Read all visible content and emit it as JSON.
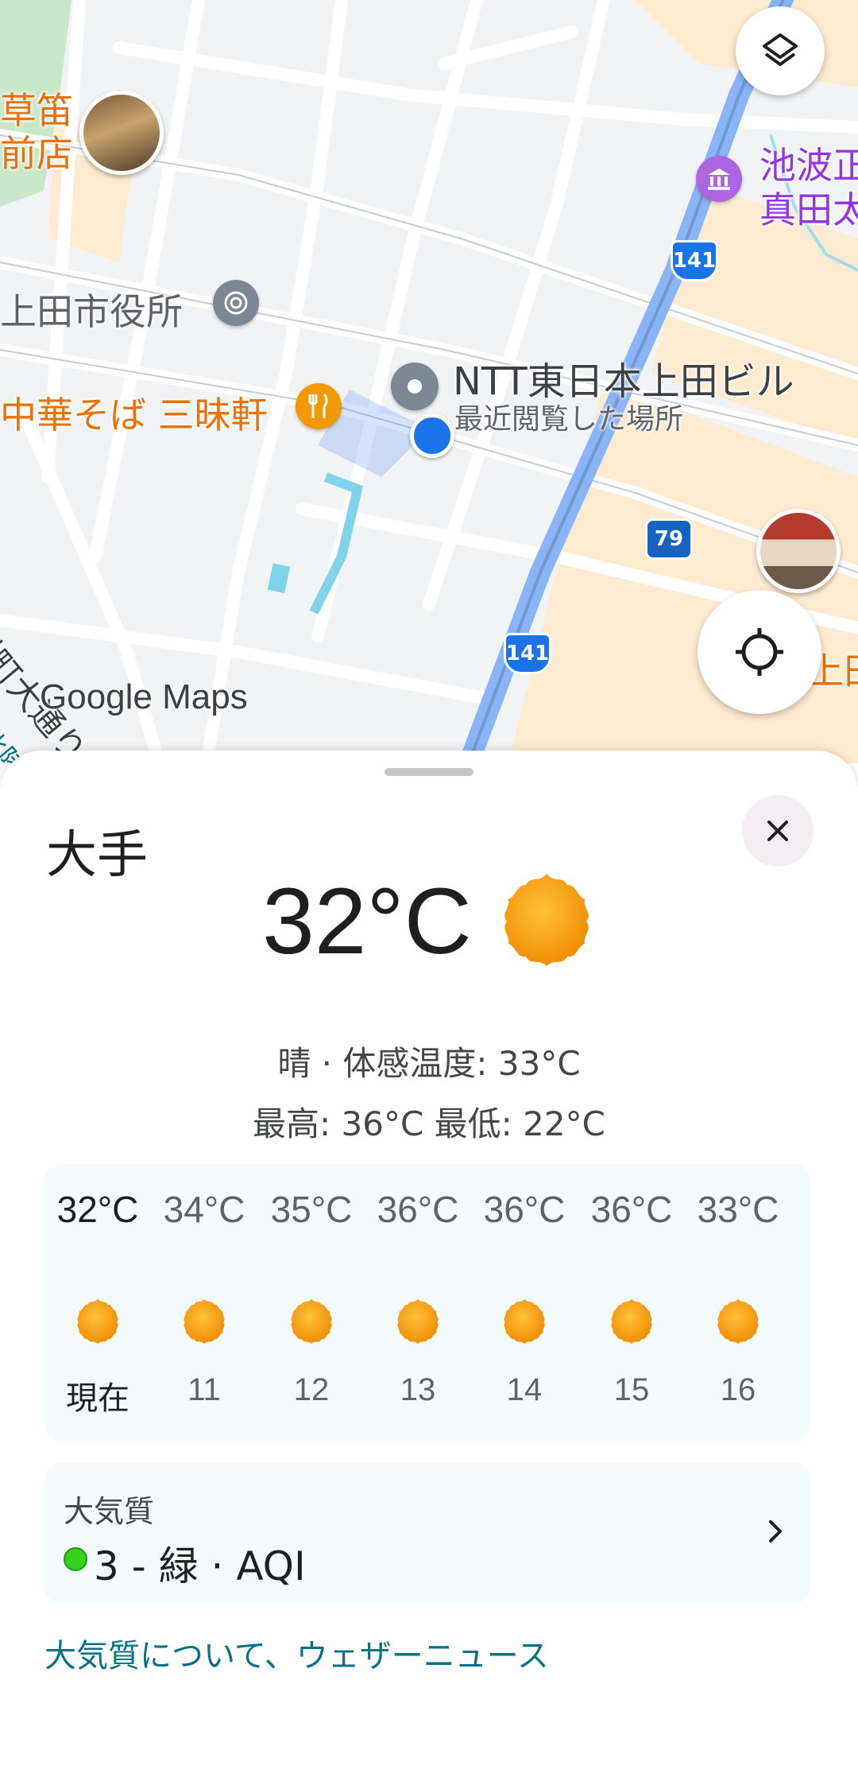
{
  "map": {
    "logo_text": "Google Maps",
    "labels": {
      "restaurant_top_left_line1": "草笛",
      "restaurant_top_left_line2": "前店",
      "city_hall": "上田市役所",
      "ramen": "中華そば 三昧軒",
      "ntt_title": "NTT東日本上田ビル",
      "ntt_subtitle": "最近閲覧した場所",
      "museum_line1": "池波正",
      "museum_line2": "真田太",
      "street_left": "紺町大通り",
      "street_bottom_left": "北陸",
      "right_edge": "上田"
    },
    "route_shields": [
      "141",
      "79",
      "141"
    ],
    "icons": {
      "layers": "layers-icon",
      "my_location": "crosshair-icon"
    }
  },
  "sheet": {
    "place_name": "大手",
    "current_temp": "32°C",
    "feels_like": "晴 · 体感温度: 33°C",
    "high_low": "最高: 36°C 最低: 22°C",
    "hourly": [
      {
        "temp": "32°C",
        "time": "現在"
      },
      {
        "temp": "34°C",
        "time": "11"
      },
      {
        "temp": "35°C",
        "time": "12"
      },
      {
        "temp": "36°C",
        "time": "13"
      },
      {
        "temp": "36°C",
        "time": "14"
      },
      {
        "temp": "36°C",
        "time": "15"
      },
      {
        "temp": "33°C",
        "time": "16"
      }
    ],
    "air_quality": {
      "title": "大気質",
      "value": "3 - 緑 · AQI",
      "status_color": "#32d21e"
    },
    "link_text": "大気質について、ウェザーニュース"
  },
  "colors": {
    "sun": "#f9a825",
    "link": "#0b7285",
    "restaurant": "#e8710a",
    "museum": "#9334e6"
  }
}
